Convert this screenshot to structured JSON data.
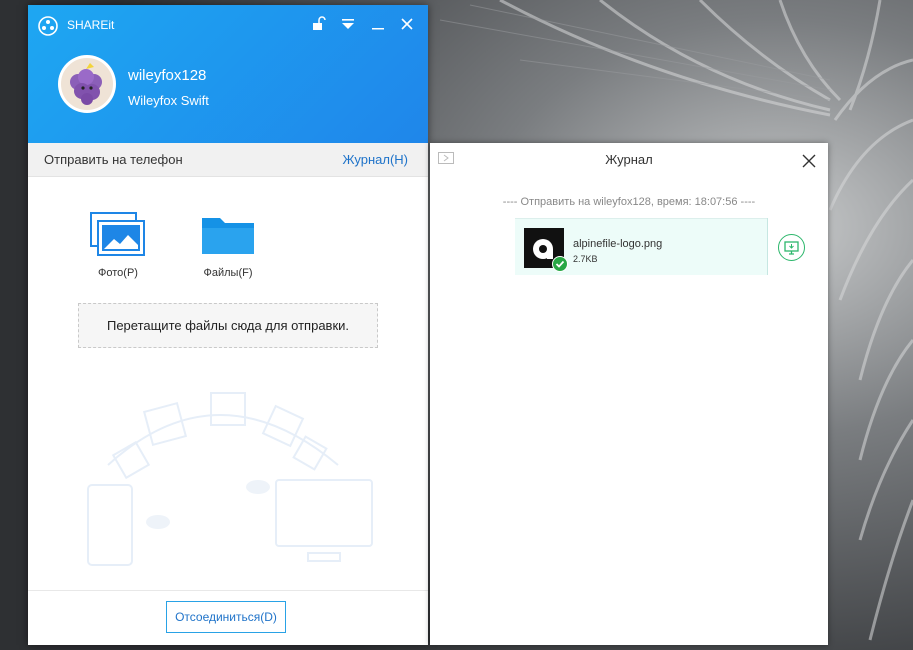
{
  "app": {
    "title": "SHAREit"
  },
  "profile": {
    "user_name": "wileyfox128",
    "device_name": "Wileyfox Swift"
  },
  "tabbar": {
    "send_label": "Отправить на телефон",
    "journal_link": "Журнал(H)"
  },
  "send_options": [
    {
      "label": "Фото(P)",
      "icon": "photo-icon"
    },
    {
      "label": "Файлы(F)",
      "icon": "folder-icon"
    }
  ],
  "dropzone": {
    "text": "Перетащите файлы сюда для отправки."
  },
  "footer": {
    "disconnect_label": "Отсоединиться(D)"
  },
  "journal_panel": {
    "title": "Журнал",
    "log_line": "---- Отправить на wileyfox128, время: 18:07:56 ----",
    "file": {
      "name": "alpinefile-logo.png",
      "size": "2.7KB",
      "status": "sent"
    }
  },
  "colors": {
    "header": "#1f8eed",
    "accent": "#1f73c9",
    "success": "#28a745",
    "file_card_bg": "#edfcf9"
  }
}
